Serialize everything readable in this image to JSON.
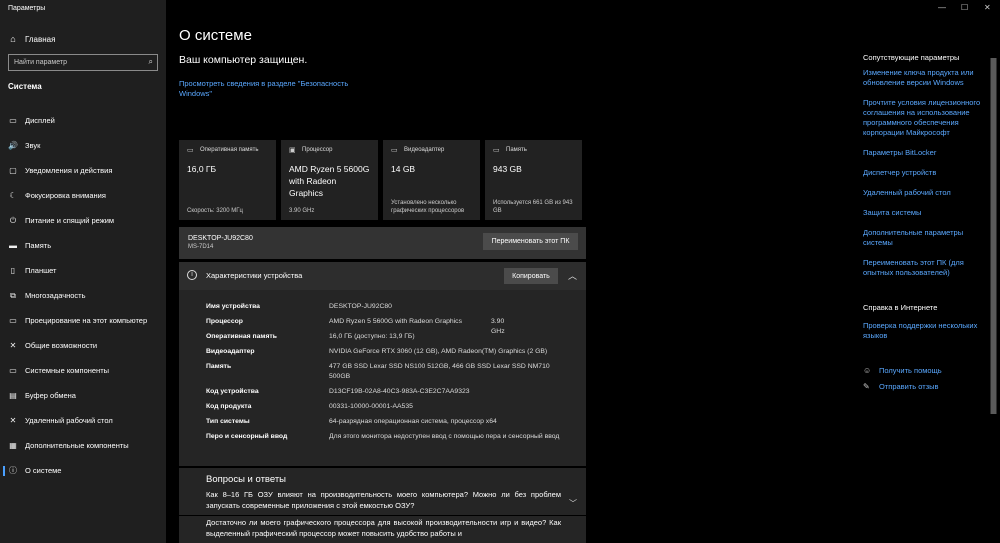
{
  "window": {
    "title": "Параметры",
    "controls": {
      "minimize": "—",
      "maximize": "☐",
      "close": "✕"
    }
  },
  "sidebar": {
    "home": "Главная",
    "search_placeholder": "Найти параметр",
    "section": "Система",
    "items": [
      {
        "label": "Дисплей",
        "icon": "display-icon",
        "glyph": "▭"
      },
      {
        "label": "Звук",
        "icon": "sound-icon",
        "glyph": "🔊"
      },
      {
        "label": "Уведомления и действия",
        "icon": "notifications-icon",
        "glyph": "▢"
      },
      {
        "label": "Фокусировка внимания",
        "icon": "focus-assist-icon",
        "glyph": "☾"
      },
      {
        "label": "Питание и спящий режим",
        "icon": "power-icon",
        "glyph": "⏻"
      },
      {
        "label": "Память",
        "icon": "storage-icon",
        "glyph": "▬"
      },
      {
        "label": "Планшет",
        "icon": "tablet-icon",
        "glyph": "▯"
      },
      {
        "label": "Многозадачность",
        "icon": "multitasking-icon",
        "glyph": "⧉"
      },
      {
        "label": "Проецирование на этот компьютер",
        "icon": "projecting-icon",
        "glyph": "▭"
      },
      {
        "label": "Общие возможности",
        "icon": "shared-experiences-icon",
        "glyph": "✕"
      },
      {
        "label": "Системные компоненты",
        "icon": "system-components-icon",
        "glyph": "▭"
      },
      {
        "label": "Буфер обмена",
        "icon": "clipboard-icon",
        "glyph": "▤"
      },
      {
        "label": "Удаленный рабочий стол",
        "icon": "remote-desktop-icon",
        "glyph": "✕"
      },
      {
        "label": "Дополнительные компоненты",
        "icon": "optional-features-icon",
        "glyph": "▦"
      },
      {
        "label": "О системе",
        "icon": "info-icon",
        "glyph": "ⓘ"
      }
    ],
    "active_index": 14
  },
  "main": {
    "title": "О системе",
    "protection_status": "Ваш компьютер защищен.",
    "protection_link": "Просмотреть сведения в разделе \"Безопасность Windows\"",
    "tiles": [
      {
        "icon": "ram-icon",
        "glyph": "▭",
        "label": "Оперативная память",
        "value": "16,0 ГБ",
        "footer": "Скорость: 3200 МГц"
      },
      {
        "icon": "cpu-icon",
        "glyph": "▣",
        "label": "Процессор",
        "value": "AMD Ryzen 5 5600G with Radeon Graphics",
        "footer": "3.90 GHz"
      },
      {
        "icon": "gpu-icon",
        "glyph": "▭",
        "label": "Видеоадаптер",
        "value": "14 GB",
        "footer": "Установлено несколько графических процессоров"
      },
      {
        "icon": "storage-icon",
        "glyph": "▭",
        "label": "Память",
        "value": "943 GB",
        "footer": "Используется 661 GB из 943 GB"
      }
    ],
    "device": {
      "name": "DESKTOP-JU92C80",
      "model": "MS-7D14",
      "rename_button": "Переименовать этот ПК"
    },
    "specs": {
      "header": "Характеристики устройства",
      "copy_button": "Копировать",
      "rows": [
        {
          "key": "Имя устройства",
          "value": "DESKTOP-JU92C80",
          "extra": ""
        },
        {
          "key": "Процессор",
          "value": "AMD Ryzen 5 5600G with Radeon Graphics",
          "extra": "3.90 GHz"
        },
        {
          "key": "Оперативная память",
          "value": "16,0 ГБ (доступно: 13,9 ГБ)",
          "extra": ""
        },
        {
          "key": "Видеоадаптер",
          "value": "NVIDIA GeForce RTX 3060 (12 GB), AMD Radeon(TM) Graphics (2 GB)",
          "extra": ""
        },
        {
          "key": "Память",
          "value": "477 GB SSD Lexar SSD NS100 512GB, 466 GB SSD Lexar SSD NM710 500GB",
          "extra": ""
        },
        {
          "key": "Код устройства",
          "value": "D13CF19B-02A8-40C3-983A-C3E2C7AA9323",
          "extra": ""
        },
        {
          "key": "Код продукта",
          "value": "00331-10000-00001-AA535",
          "extra": ""
        },
        {
          "key": "Тип системы",
          "value": "64-разрядная операционная система, процессор x64",
          "extra": ""
        },
        {
          "key": "Перо и сенсорный ввод",
          "value": "Для этого монитора недоступен ввод с помощью пера и сенсорный ввод",
          "extra": ""
        }
      ]
    },
    "qa": {
      "title": "Вопросы и ответы",
      "questions": [
        "Как 8–16 ГБ ОЗУ влияют на производительность моего компьютера? Можно ли без проблем запускать современные приложения с этой емкостью ОЗУ?",
        "Достаточно ли моего графического процессора для высокой производительности игр и видео? Как выделенный графический процессор может повысить удобство работы и"
      ]
    }
  },
  "right_panel": {
    "related_title": "Сопутствующие параметры",
    "related_links": [
      "Изменение ключа продукта или обновление версии Windows",
      "Прочтите условия лицензионного соглашения на использование программного обеспечения корпорации Майкрософт",
      "Параметры BitLocker",
      "Диспетчер устройств",
      "Удаленный рабочий стол",
      "Защита системы",
      "Дополнительные параметры системы",
      "Переименовать этот ПК (для опытных пользователей)"
    ],
    "web_help_title": "Справка в Интернете",
    "web_help_links": [
      "Проверка поддержки нескольких языков"
    ],
    "help_links": [
      {
        "label": "Получить помощь",
        "icon": "get-help-icon",
        "glyph": "☺"
      },
      {
        "label": "Отправить отзыв",
        "icon": "feedback-icon",
        "glyph": "✎"
      }
    ]
  },
  "colors": {
    "accent": "#5aa8ff",
    "sidebar_bg": "#1f1f1f",
    "panel_bg": "#252525"
  }
}
